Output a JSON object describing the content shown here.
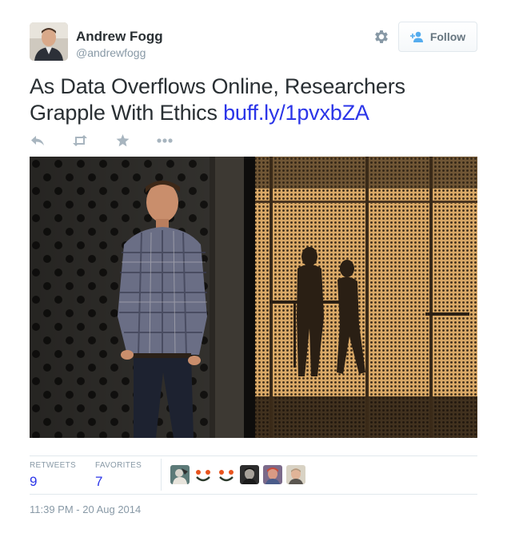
{
  "user": {
    "full_name": "Andrew Fogg",
    "username": "@andrewfogg"
  },
  "header": {
    "follow_label": "Follow"
  },
  "tweet": {
    "text": "As Data Overflows Online, Researchers Grapple With Ethics ",
    "link_text": "buff.ly/1pvxbZA"
  },
  "stats": {
    "retweets_label": "RETWEETS",
    "retweets_count": "9",
    "favorites_label": "FAVORITES",
    "favorites_count": "7"
  },
  "favoriters": [
    "user-avatar-1",
    "smiley-avatar-1",
    "smiley-avatar-2",
    "user-avatar-2",
    "user-avatar-3",
    "user-avatar-4"
  ],
  "timestamp": "11:39 PM - 20 Aug 2014",
  "colors": {
    "link": "#2b35e8",
    "text": "#292f33",
    "muted": "#8899a6",
    "icon": "#8899a6"
  },
  "icons": {
    "settings": "gear-icon",
    "follow": "add-person-icon",
    "reply": "reply-icon",
    "retweet": "retweet-icon",
    "favorite": "star-icon",
    "more": "ellipsis-icon"
  }
}
